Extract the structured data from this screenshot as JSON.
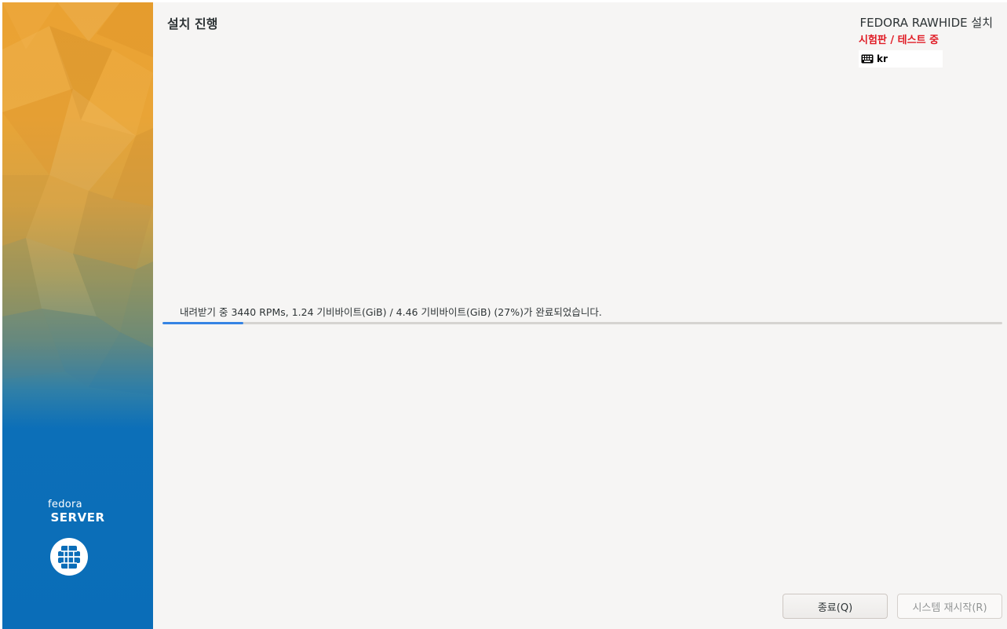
{
  "sidebar": {
    "brand_fedora": "fedora",
    "brand_server": "SERVER",
    "logo_icon": "fedora-server-icon"
  },
  "header": {
    "page_title": "설치 진행",
    "product_title": "FEDORA RAWHIDE 설치",
    "beta_notice": "시험판 / 테스트 중",
    "keyboard_layout": "kr",
    "keyboard_icon": "keyboard-icon"
  },
  "progress": {
    "status_text": "내려받기 중 3440 RPMs, 1.24 기비바이트(GiB) / 4.46 기비바이트(GiB) (27%)가 완료되었습니다.",
    "bar_fraction": 0.096
  },
  "buttons": {
    "quit_label": "종료(Q)",
    "reboot_label": "시스템 재시작(R)"
  },
  "colors": {
    "accent": "#3584e4",
    "beta_red": "#e01b24",
    "sidebar_blue": "#0a6db8",
    "sidebar_orange": "#eaa232"
  }
}
